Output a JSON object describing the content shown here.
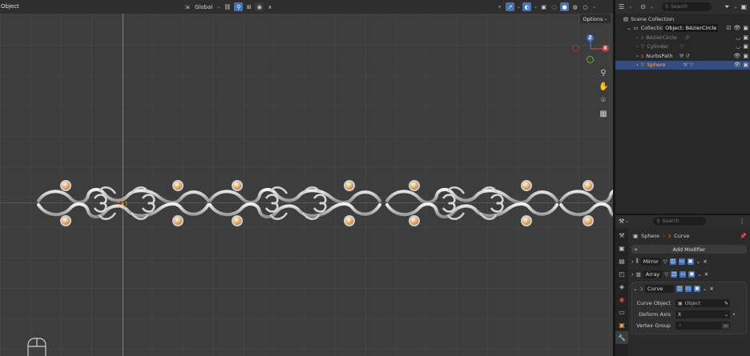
{
  "viewport": {
    "mode_label": "Object",
    "orientation_label": "Global",
    "options_label": "Options",
    "gizmo": {
      "z": "Z",
      "x": "X",
      "y": "Y"
    },
    "colors": {
      "accent": "#4772b3",
      "x_axis": "#a04444",
      "y_axis": "#8b9b3a",
      "metal": "#c8c8c8",
      "gem": "#e0a060"
    }
  },
  "outliner": {
    "search_placeholder": "Search",
    "tooltip": "Object: BézierCircle",
    "scene_label": "Scene Collection",
    "collection_label": "Collectic",
    "items": [
      {
        "label": "BézierCircle",
        "type": "curve",
        "hidden": true
      },
      {
        "label": "Cylinder",
        "type": "mesh",
        "hidden": true
      },
      {
        "label": "NurbsPath",
        "type": "curve",
        "hidden": false
      },
      {
        "label": "Sphere",
        "type": "mesh",
        "selected": true
      }
    ]
  },
  "properties": {
    "search_placeholder": "Search",
    "breadcrumb_object": "Sphere",
    "breadcrumb_modifier": "Curve",
    "add_modifier_label": "Add Modifier",
    "modifiers": [
      {
        "name": "Mirror",
        "expanded": false
      },
      {
        "name": "Array",
        "expanded": false
      },
      {
        "name": "Curve",
        "expanded": true
      }
    ],
    "curve_fields": {
      "curve_object_label": "Curve Object",
      "curve_object_placeholder": "Object",
      "deform_axis_label": "Deform Axis",
      "deform_axis_value": "X",
      "vertex_group_label": "Vertex Group",
      "vertex_group_value": ""
    }
  }
}
